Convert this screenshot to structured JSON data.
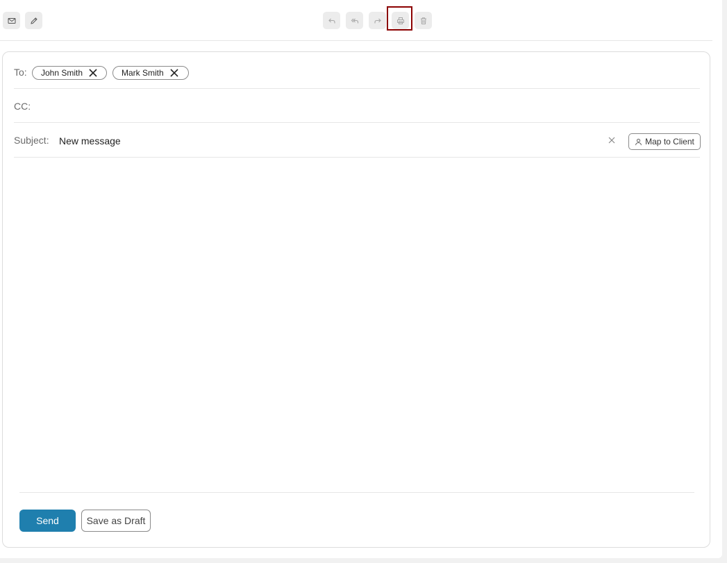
{
  "toolbar": {
    "left_icons": [
      "envelope-icon",
      "pencil-icon"
    ],
    "center_icons": [
      "reply-icon",
      "reply-all-icon",
      "forward-icon",
      "print-icon",
      "trash-icon"
    ],
    "highlighted": "print-icon",
    "highlight_color": "#8b0000"
  },
  "compose": {
    "to_label": "To:",
    "recipients": [
      "John Smith",
      "Mark Smith"
    ],
    "cc_label": "CC:",
    "subject_label": "Subject:",
    "subject_value": "New message",
    "map_to_client_label": "Map to Client",
    "body_text": ""
  },
  "actions": {
    "send_label": "Send",
    "save_draft_label": "Save as Draft"
  },
  "colors": {
    "accent": "#1f7fae",
    "border": "#dcdcdc",
    "toolbar_button": "#ececec"
  }
}
